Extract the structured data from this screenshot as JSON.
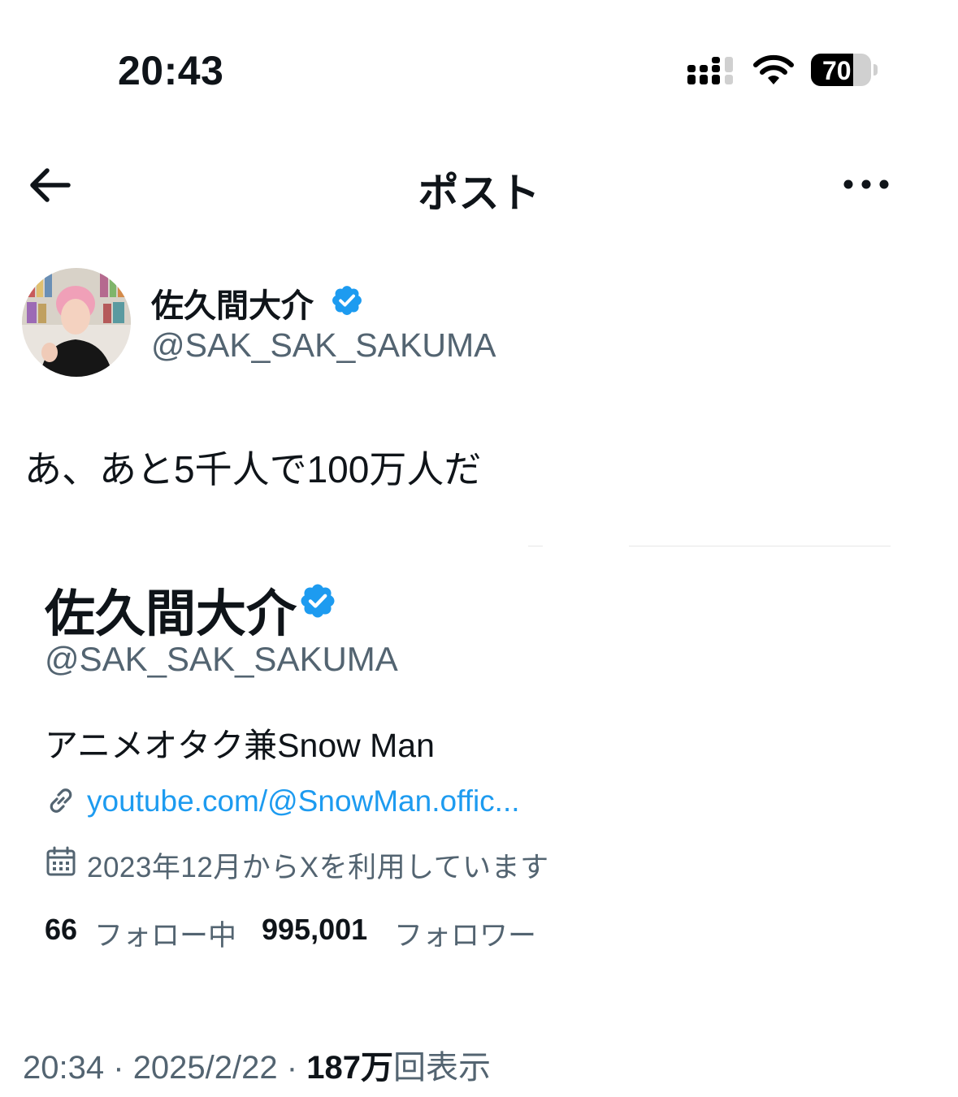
{
  "status_bar": {
    "time": "20:43",
    "battery_level": "70",
    "battery_fraction": 0.7
  },
  "header": {
    "title": "ポスト",
    "back_icon": "arrow-left-icon",
    "more_icon": "more-horizontal-icon"
  },
  "author": {
    "name": "佐久間大介",
    "handle": "@SAK_SAK_SAKUMA",
    "verified": true
  },
  "tweet": {
    "text": "あ、あと5千人で100万人だ"
  },
  "profile_card": {
    "name": "佐久間大介",
    "handle": "@SAK_SAK_SAKUMA",
    "bio": "アニメオタク兼Snow Man",
    "link": "youtube.com/@SnowMan.offic...",
    "joined": "2023年12月からXを利用しています",
    "following_count": "66",
    "following_label": "フォロー中",
    "followers_count": "995,001",
    "followers_label": "フォロワー"
  },
  "meta": {
    "time": "20:34",
    "separator": "·",
    "date": "2025/2/22",
    "views_count": "187万",
    "views_label": "回表示"
  },
  "colors": {
    "text_primary": "#0f1419",
    "text_secondary": "#536471",
    "link": "#1d9bf0",
    "verified": "#1d9bf0"
  }
}
